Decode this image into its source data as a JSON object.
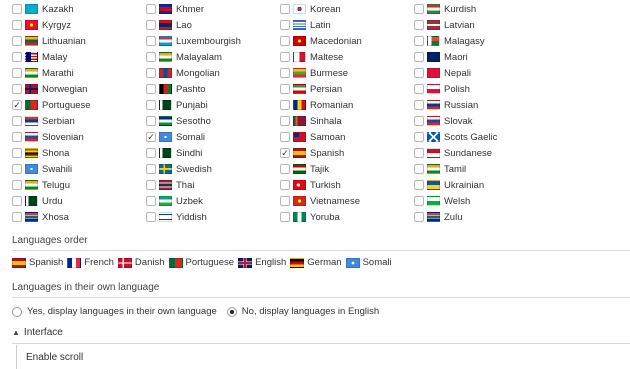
{
  "languages": [
    {
      "label": "Kazakh",
      "checked": false,
      "flag": "kz"
    },
    {
      "label": "Khmer",
      "checked": false,
      "flag": "kh"
    },
    {
      "label": "Korean",
      "checked": false,
      "flag": "kr"
    },
    {
      "label": "Kurdish",
      "checked": false,
      "flag": "ku"
    },
    {
      "label": "Kyrgyz",
      "checked": false,
      "flag": "kg"
    },
    {
      "label": "Lao",
      "checked": false,
      "flag": "la"
    },
    {
      "label": "Latin",
      "checked": false,
      "flag": "latin"
    },
    {
      "label": "Latvian",
      "checked": false,
      "flag": "lv"
    },
    {
      "label": "Lithuanian",
      "checked": false,
      "flag": "lt"
    },
    {
      "label": "Luxembourgish",
      "checked": false,
      "flag": "lu"
    },
    {
      "label": "Macedonian",
      "checked": false,
      "flag": "mk"
    },
    {
      "label": "Malagasy",
      "checked": false,
      "flag": "mg"
    },
    {
      "label": "Malay",
      "checked": false,
      "flag": "my"
    },
    {
      "label": "Malayalam",
      "checked": false,
      "flag": "in"
    },
    {
      "label": "Maltese",
      "checked": false,
      "flag": "mt"
    },
    {
      "label": "Maori",
      "checked": false,
      "flag": "nz"
    },
    {
      "label": "Marathi",
      "checked": false,
      "flag": "in"
    },
    {
      "label": "Mongolian",
      "checked": false,
      "flag": "mn"
    },
    {
      "label": "Burmese",
      "checked": false,
      "flag": "mm"
    },
    {
      "label": "Nepali",
      "checked": false,
      "flag": "np"
    },
    {
      "label": "Norwegian",
      "checked": false,
      "flag": "no"
    },
    {
      "label": "Pashto",
      "checked": false,
      "flag": "af"
    },
    {
      "label": "Persian",
      "checked": false,
      "flag": "ir"
    },
    {
      "label": "Polish",
      "checked": false,
      "flag": "pl"
    },
    {
      "label": "Portuguese",
      "checked": true,
      "flag": "pt"
    },
    {
      "label": "Punjabi",
      "checked": false,
      "flag": "pk"
    },
    {
      "label": "Romanian",
      "checked": false,
      "flag": "ro"
    },
    {
      "label": "Russian",
      "checked": false,
      "flag": "ru"
    },
    {
      "label": "Serbian",
      "checked": false,
      "flag": "rs"
    },
    {
      "label": "Sesotho",
      "checked": false,
      "flag": "ls"
    },
    {
      "label": "Sinhala",
      "checked": false,
      "flag": "lk"
    },
    {
      "label": "Slovak",
      "checked": false,
      "flag": "sk"
    },
    {
      "label": "Slovenian",
      "checked": false,
      "flag": "si"
    },
    {
      "label": "Somali",
      "checked": true,
      "flag": "so"
    },
    {
      "label": "Samoan",
      "checked": false,
      "flag": "ws"
    },
    {
      "label": "Scots Gaelic",
      "checked": false,
      "flag": "sco"
    },
    {
      "label": "Shona",
      "checked": false,
      "flag": "zw"
    },
    {
      "label": "Sindhi",
      "checked": false,
      "flag": "pk"
    },
    {
      "label": "Spanish",
      "checked": true,
      "flag": "es"
    },
    {
      "label": "Sundanese",
      "checked": false,
      "flag": "id"
    },
    {
      "label": "Swahili",
      "checked": false,
      "flag": "so"
    },
    {
      "label": "Swedish",
      "checked": false,
      "flag": "se"
    },
    {
      "label": "Tajik",
      "checked": false,
      "flag": "tj"
    },
    {
      "label": "Tamil",
      "checked": false,
      "flag": "in"
    },
    {
      "label": "Telugu",
      "checked": false,
      "flag": "in"
    },
    {
      "label": "Thai",
      "checked": false,
      "flag": "th"
    },
    {
      "label": "Turkish",
      "checked": false,
      "flag": "tr"
    },
    {
      "label": "Ukrainian",
      "checked": false,
      "flag": "ua"
    },
    {
      "label": "Urdu",
      "checked": false,
      "flag": "pk"
    },
    {
      "label": "Uzbek",
      "checked": false,
      "flag": "uz"
    },
    {
      "label": "Vietnamese",
      "checked": false,
      "flag": "vn"
    },
    {
      "label": "Welsh",
      "checked": false,
      "flag": "wales"
    },
    {
      "label": "Xhosa",
      "checked": false,
      "flag": "za"
    },
    {
      "label": "Yiddish",
      "checked": false,
      "flag": "il"
    },
    {
      "label": "Yoruba",
      "checked": false,
      "flag": "ng"
    },
    {
      "label": "Zulu",
      "checked": false,
      "flag": "za"
    }
  ],
  "order": {
    "title": "Languages order",
    "items": [
      {
        "label": "Spanish",
        "flag": "es"
      },
      {
        "label": "French",
        "flag": "fr"
      },
      {
        "label": "Danish",
        "flag": "dk"
      },
      {
        "label": "Portuguese",
        "flag": "pt"
      },
      {
        "label": "English",
        "flag": "gb"
      },
      {
        "label": "German",
        "flag": "de"
      },
      {
        "label": "Somali",
        "flag": "so"
      }
    ]
  },
  "own_language": {
    "title": "Languages in their own language",
    "options": [
      {
        "label": "Yes, display languages in their own language",
        "selected": false
      },
      {
        "label": "No, display languages in English",
        "selected": true
      }
    ]
  },
  "interface": {
    "title": "Interface",
    "items": [
      "Enable scroll"
    ]
  },
  "check_mark": "✓",
  "caret_icon": "▲"
}
